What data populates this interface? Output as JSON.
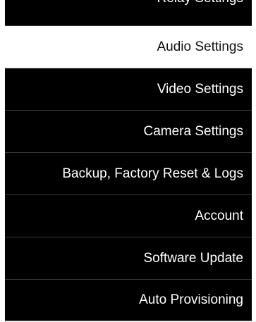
{
  "menu": {
    "items": [
      {
        "label": "Relay Settings"
      },
      {
        "label": "Audio Settings",
        "active": true
      },
      {
        "label": "Video Settings"
      },
      {
        "label": "Camera Settings"
      },
      {
        "label": "Backup, Factory Reset & Logs"
      },
      {
        "label": "Account"
      },
      {
        "label": "Software Update"
      },
      {
        "label": "Auto Provisioning"
      }
    ]
  },
  "colors": {
    "item_background": "#000000",
    "item_text": "#ffffff",
    "active_background": "#ffffff",
    "active_text": "#111111"
  }
}
